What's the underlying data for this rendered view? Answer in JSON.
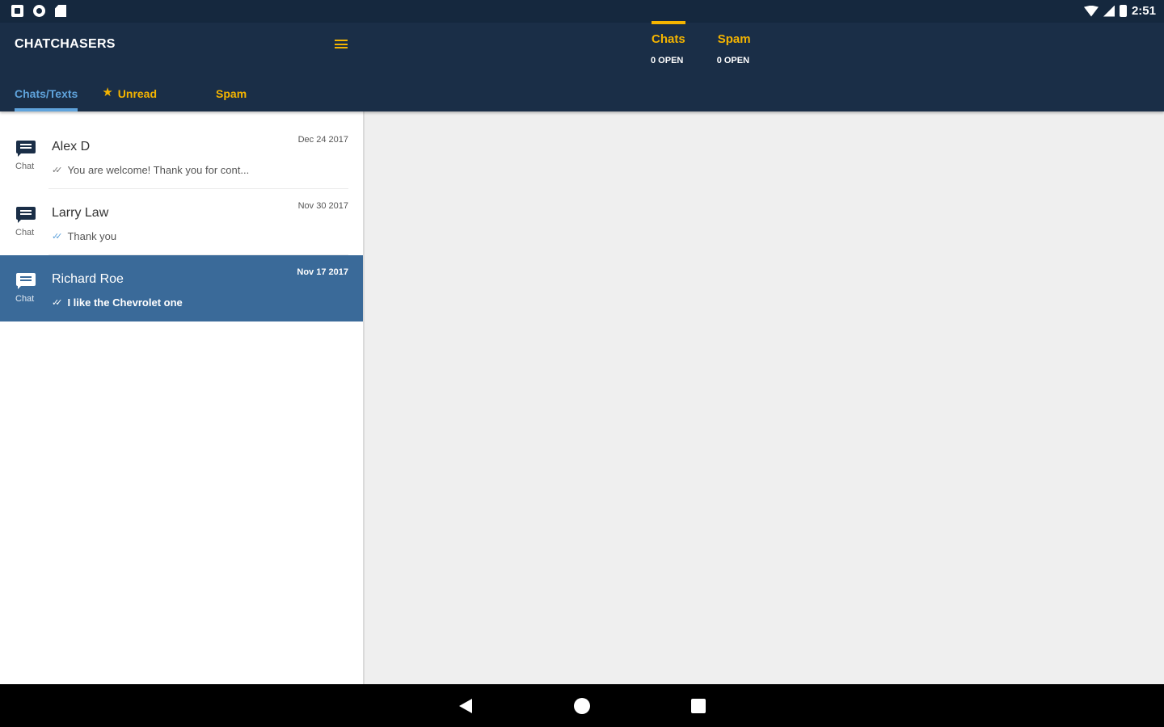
{
  "status_bar": {
    "time": "2:51",
    "left_icons": [
      "photo-icon",
      "ring-icon",
      "sd-card-icon"
    ],
    "right_icons": [
      "wifi-icon",
      "signal-icon",
      "battery-icon"
    ]
  },
  "header": {
    "brand": "CHATCHASERS",
    "menu_icon": "menu-icon",
    "list_tabs": [
      {
        "label": "Chats/Texts",
        "active": true
      },
      {
        "label": "Unread",
        "icon": "star-icon",
        "active": false
      },
      {
        "label": "Spam",
        "active": false
      }
    ],
    "queue_tabs": [
      {
        "label": "Chats",
        "count": "0 OPEN",
        "active": true
      },
      {
        "label": "Spam",
        "count": "0 OPEN",
        "active": false
      }
    ]
  },
  "chats": [
    {
      "name": "Alex D",
      "type": "Chat",
      "date": "Dec 24 2017",
      "preview": "You are welcome! Thank you for cont...",
      "read": false,
      "selected": false
    },
    {
      "name": "Larry Law",
      "type": "Chat",
      "date": "Nov 30 2017",
      "preview": "Thank you",
      "read": true,
      "selected": false
    },
    {
      "name": "Richard Roe",
      "type": "Chat",
      "date": "Nov 17 2017",
      "preview": "I like the Chevrolet one",
      "read": false,
      "selected": true
    }
  ],
  "colors": {
    "header_bg": "#1a2e47",
    "status_bg": "#15283e",
    "accent_yellow": "#f4b400",
    "accent_blue": "#5fa3dc",
    "selected_row": "#3a6a99"
  }
}
